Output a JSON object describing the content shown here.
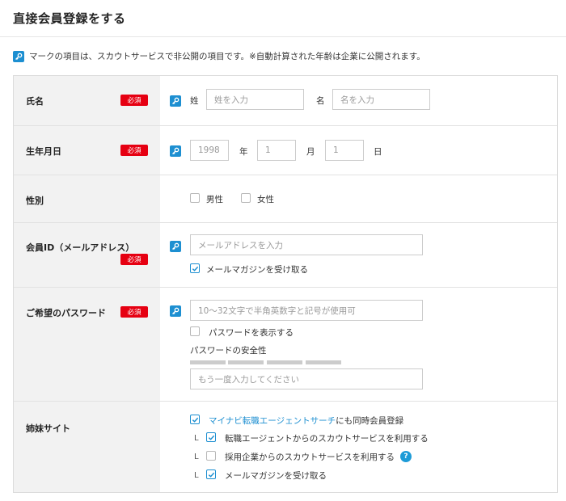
{
  "header": {
    "title": "直接会員登録をする"
  },
  "note": {
    "text": "マークの項目は、スカウトサービスで非公開の項目です。※自動計算された年齢は企業に公開されます。",
    "icon": "key-icon"
  },
  "colors": {
    "accent": "#1d8fd1",
    "required": "#e60012"
  },
  "required_badge": "必須",
  "rows": {
    "name": {
      "label": "氏名",
      "sei_label": "姓",
      "sei_placeholder": "姓を入力",
      "mei_label": "名",
      "mei_placeholder": "名を入力"
    },
    "birthday": {
      "label": "生年月日",
      "year_value": "1998",
      "year_unit": "年",
      "month_value": "1",
      "month_unit": "月",
      "day_value": "1",
      "day_unit": "日"
    },
    "gender": {
      "label": "性別",
      "male": "男性",
      "female": "女性"
    },
    "member_id": {
      "label": "会員ID（メールアドレス）",
      "placeholder": "メールアドレスを入力",
      "newsletter": "メールマガジンを受け取る",
      "newsletter_checked": true
    },
    "password": {
      "label": "ご希望のパスワード",
      "placeholder": "10～32文字で半角英数字と記号が使用可",
      "show_password": "パスワードを表示する",
      "strength_label": "パスワードの安全性",
      "confirm_placeholder": "もう一度入力してください"
    },
    "sister": {
      "label": "姉妹サイト",
      "main_link": "マイナビ転職エージェントサーチ",
      "main_suffix": "にも同時会員登録",
      "branch_mark": "L",
      "opt1": "転職エージェントからのスカウトサービスを利用する",
      "opt2": "採用企業からのスカウトサービスを利用する",
      "opt3": "メールマガジンを受け取る",
      "help": "?"
    }
  }
}
